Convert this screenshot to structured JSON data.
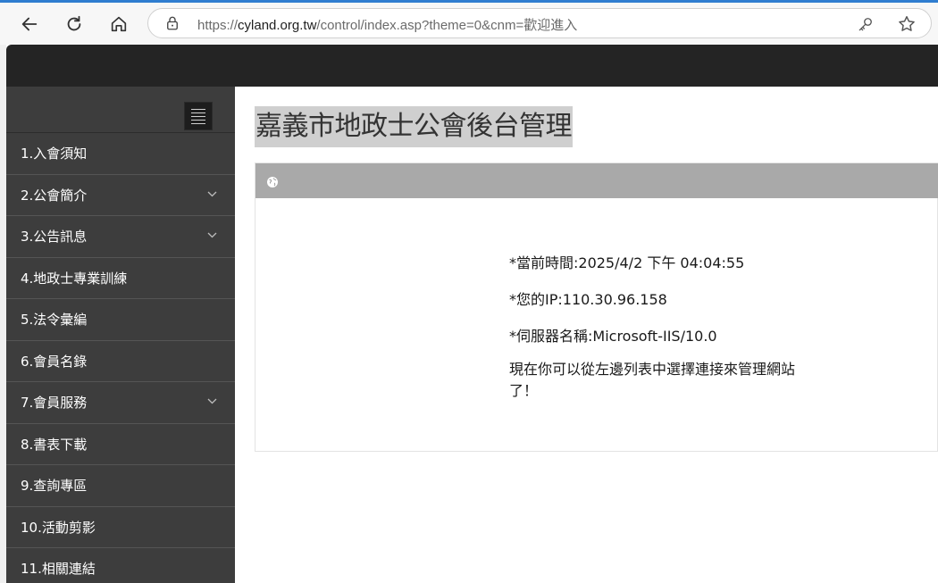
{
  "browser": {
    "url_scheme": "https://",
    "url_host": "cyland.org.tw",
    "url_path": "/control/index.asp?theme=0&cnm=歡迎進入"
  },
  "sidebar": {
    "items": [
      {
        "label": "1.入會須知",
        "has_submenu": false
      },
      {
        "label": "2.公會簡介",
        "has_submenu": true
      },
      {
        "label": "3.公告訊息",
        "has_submenu": true
      },
      {
        "label": "4.地政士專業訓練",
        "has_submenu": false
      },
      {
        "label": "5.法令彙編",
        "has_submenu": false
      },
      {
        "label": "6.會員名錄",
        "has_submenu": false
      },
      {
        "label": "7.會員服務",
        "has_submenu": true
      },
      {
        "label": "8.書表下載",
        "has_submenu": false
      },
      {
        "label": "9.查詢專區",
        "has_submenu": false
      },
      {
        "label": "10.活動剪影",
        "has_submenu": false
      },
      {
        "label": "11.相關連結",
        "has_submenu": false
      }
    ]
  },
  "main": {
    "title": "嘉義市地政士公會後台管理",
    "current_time": "*當前時間:2025/4/2 下午 04:04:55",
    "ip": "*您的IP:110.30.96.158",
    "server": "*伺服器名稱:Microsoft-IIS/10.0",
    "welcome": "現在你可以從左邊列表中選擇連接來管理網站了！"
  },
  "colors": {
    "topbar": "#242424",
    "sidebar": "#3d3d3d",
    "panel_header": "#a9a9a9",
    "title_highlight": "#cfcfcf"
  }
}
